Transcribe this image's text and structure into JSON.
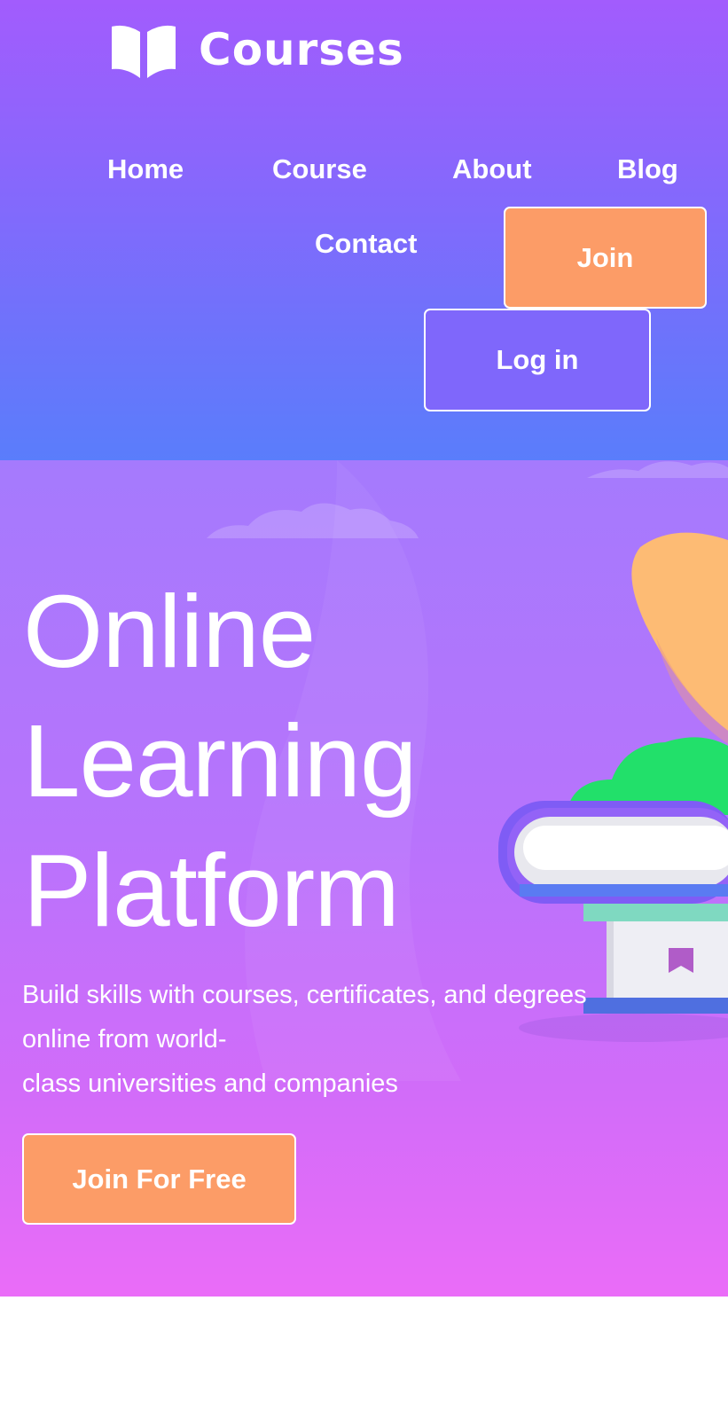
{
  "brand": {
    "name": "Courses",
    "icon": "open-book-icon"
  },
  "nav": {
    "items": [
      {
        "label": "Home"
      },
      {
        "label": "Course"
      },
      {
        "label": "About"
      },
      {
        "label": "Blog"
      },
      {
        "label": "Contact"
      }
    ],
    "join_label": "Join",
    "login_label": "Log in"
  },
  "hero": {
    "title_lines": [
      "Online",
      "Learning",
      "Platform"
    ],
    "subtitle_lines": [
      "Build skills with courses, certificates, and degrees",
      "online from world-",
      "class universities and companies"
    ],
    "cta_label": "Join For Free",
    "illustration": "books-with-plant-illustration"
  },
  "colors": {
    "header_top": "#a25cfd",
    "header_bottom": "#5a7dfb",
    "accent_orange": "#fc9c67",
    "login_button": "#7f67fb",
    "hero_top": "#a57afd",
    "hero_bottom": "#ea6cf8"
  }
}
